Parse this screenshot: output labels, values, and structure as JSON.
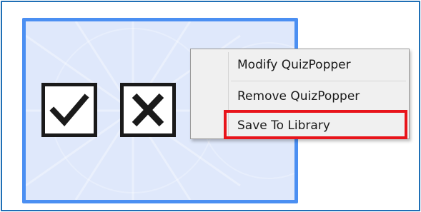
{
  "widget": {
    "border_color": "#4b8ff2",
    "background_color": "#dfe8fb",
    "icons": [
      "checkmark-icon",
      "cross-icon"
    ]
  },
  "context_menu": {
    "items": [
      {
        "label": "Modify QuizPopper"
      },
      {
        "label": "Remove QuizPopper"
      },
      {
        "label": "Save To Library",
        "highlighted": true
      }
    ],
    "highlight_color": "#e8141b"
  },
  "frame_border_color": "#1f6fb5"
}
